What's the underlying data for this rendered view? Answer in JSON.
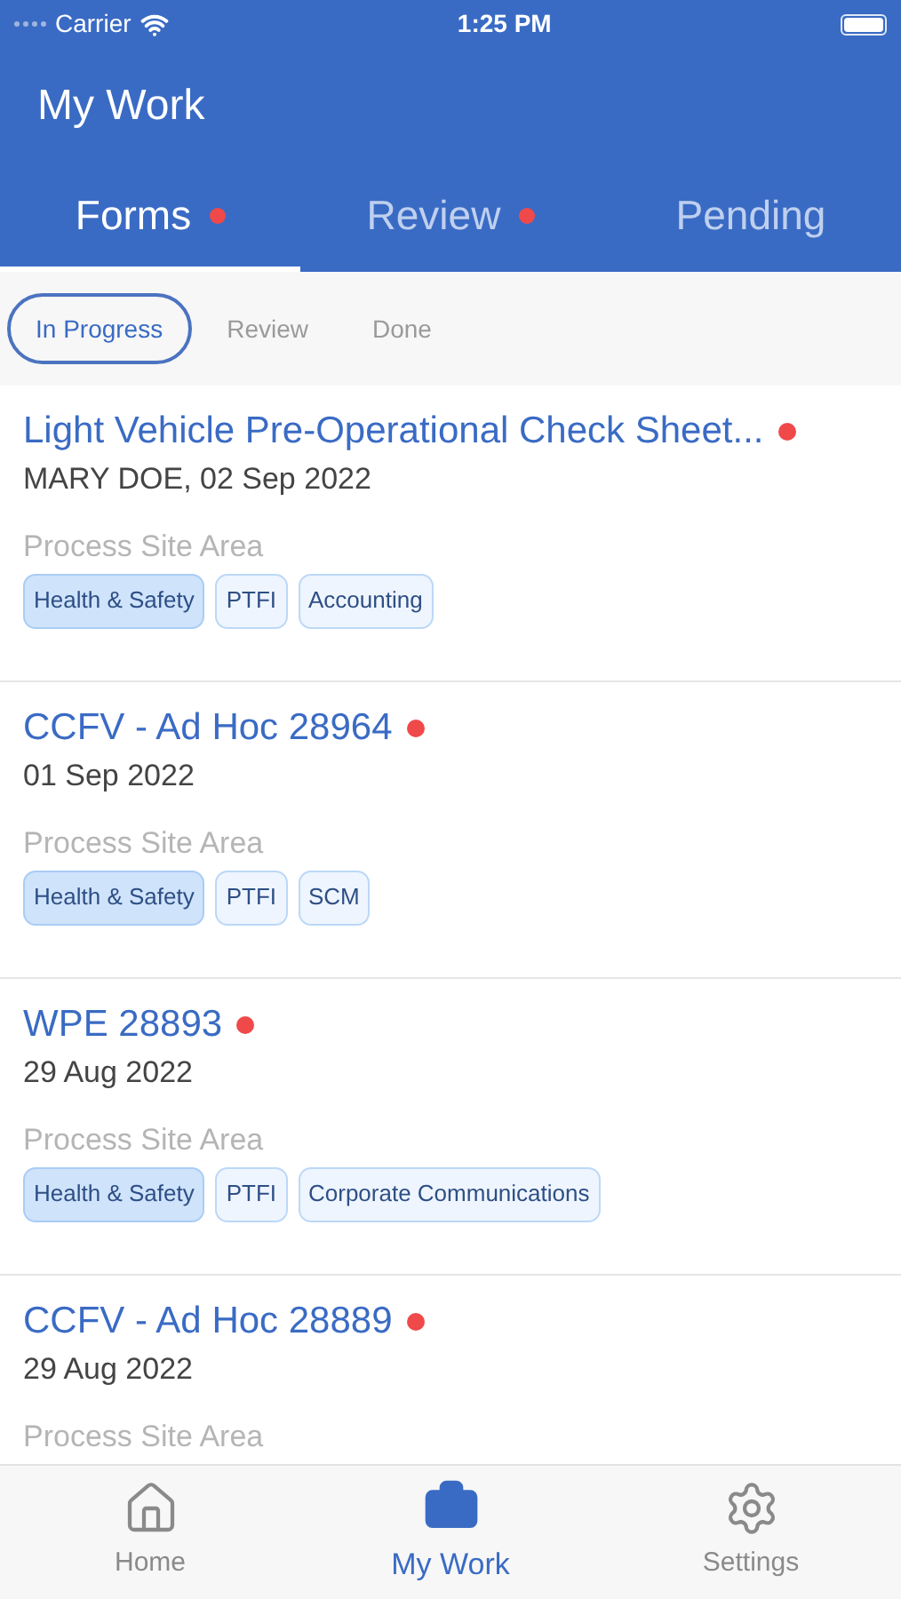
{
  "status_bar": {
    "carrier": "Carrier",
    "time": "1:25 PM"
  },
  "header": {
    "title": "My Work"
  },
  "tabs": [
    {
      "label": "Forms",
      "selected": true,
      "dot": true
    },
    {
      "label": "Review",
      "selected": false,
      "dot": true
    },
    {
      "label": "Pending",
      "selected": false,
      "dot": false
    }
  ],
  "filters": [
    {
      "label": "In Progress",
      "selected": true
    },
    {
      "label": "Review",
      "selected": false
    },
    {
      "label": "Done",
      "selected": false
    }
  ],
  "forms": [
    {
      "title": "Light Vehicle Pre-Operational Check Sheet...",
      "unread": true,
      "meta": "MARY DOE, 02 Sep 2022",
      "section": "Process Site Area",
      "tags": [
        {
          "label": "Health & Safety",
          "kind": "primary"
        },
        {
          "label": "PTFI",
          "kind": "secondary"
        },
        {
          "label": "Accounting",
          "kind": "secondary"
        }
      ]
    },
    {
      "title": "CCFV - Ad Hoc 28964",
      "unread": true,
      "meta": "01 Sep 2022",
      "section": "Process Site Area",
      "tags": [
        {
          "label": "Health & Safety",
          "kind": "primary"
        },
        {
          "label": "PTFI",
          "kind": "secondary"
        },
        {
          "label": "SCM",
          "kind": "secondary"
        }
      ]
    },
    {
      "title": "WPE 28893",
      "unread": true,
      "meta": "29 Aug 2022",
      "section": "Process Site Area",
      "tags": [
        {
          "label": "Health & Safety",
          "kind": "primary"
        },
        {
          "label": "PTFI",
          "kind": "secondary"
        },
        {
          "label": "Corporate Communications",
          "kind": "secondary"
        }
      ]
    },
    {
      "title": "CCFV - Ad Hoc 28889",
      "unread": true,
      "meta": "29 Aug 2022",
      "section": "Process Site Area"
    }
  ],
  "tab_bar": [
    {
      "label": "Home",
      "kind": "home",
      "selected": false
    },
    {
      "label": "My Work",
      "kind": "work",
      "selected": true
    },
    {
      "label": "Settings",
      "kind": "settings",
      "selected": false
    }
  ]
}
